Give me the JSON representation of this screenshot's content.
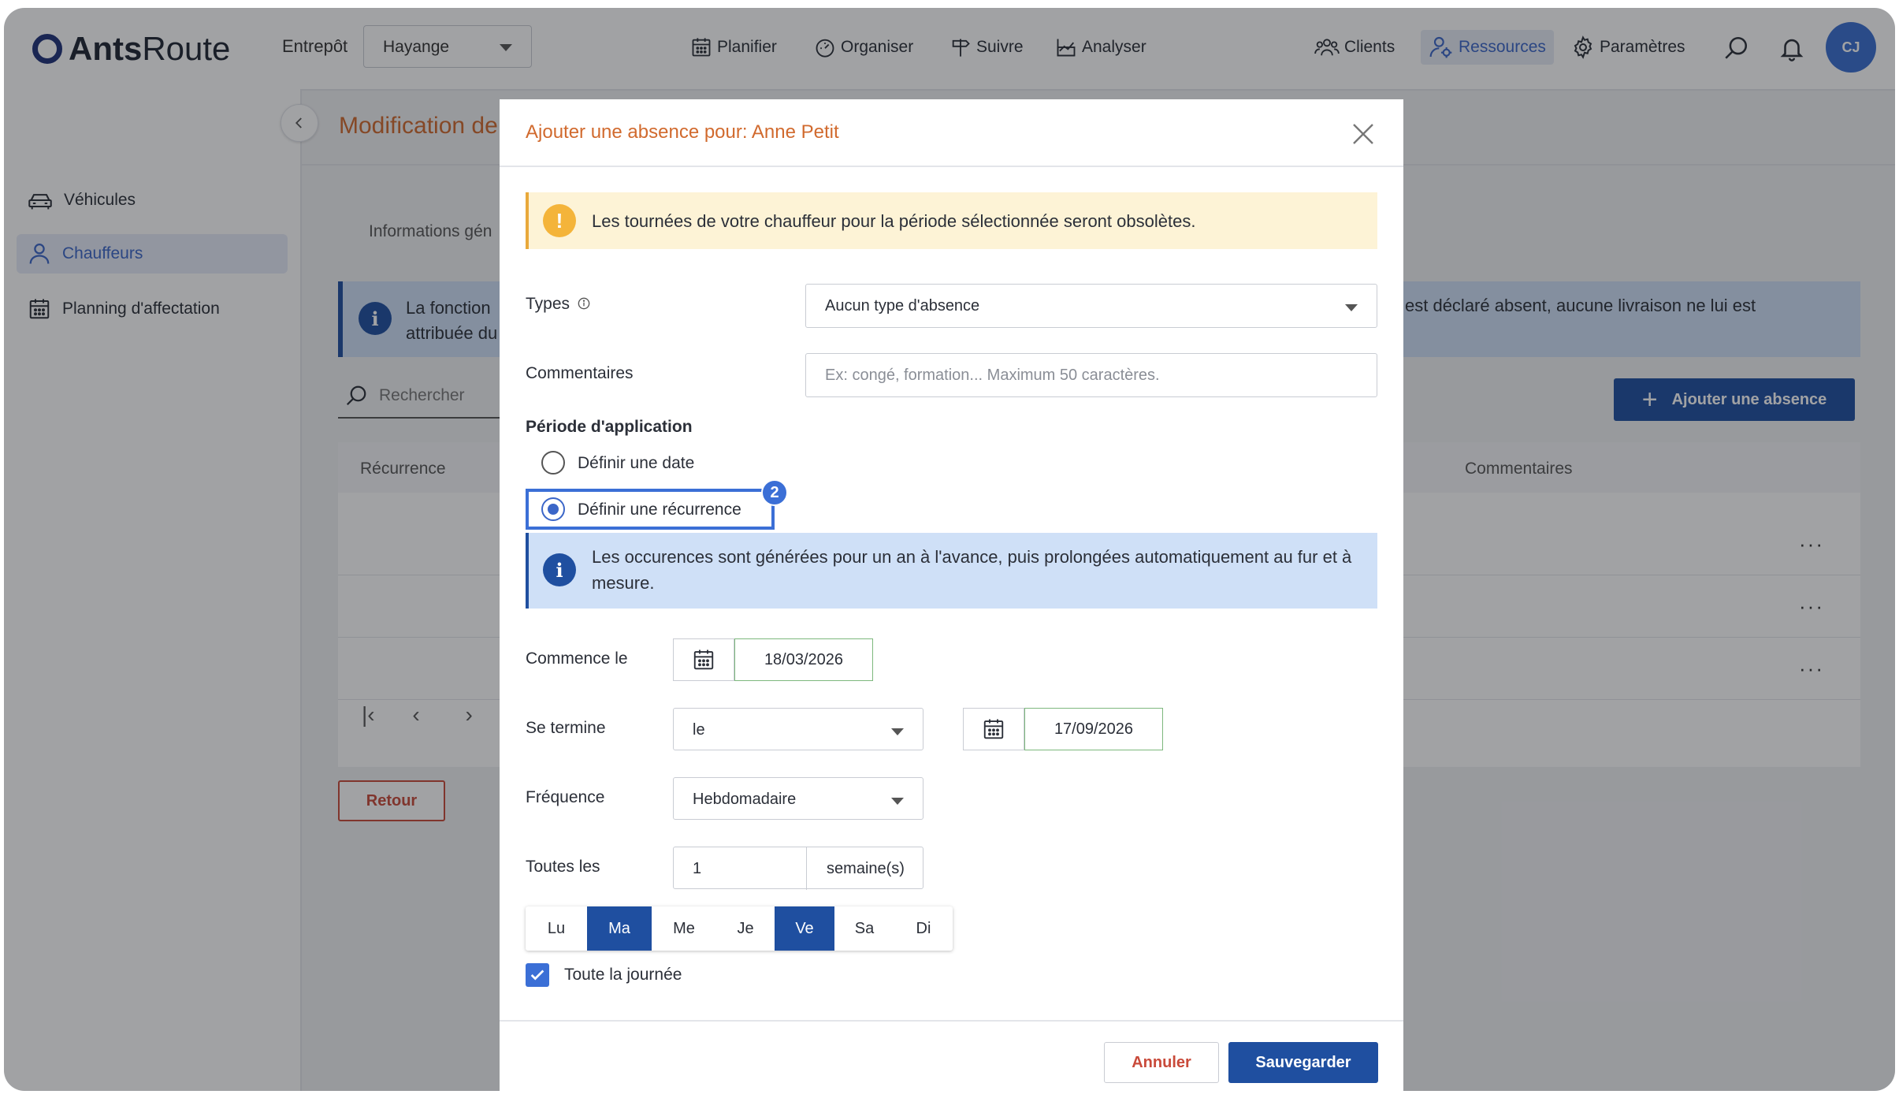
{
  "app": {
    "logo_bold": "Ants",
    "logo_light": "Route"
  },
  "header": {
    "warehouse_label": "Entrepôt",
    "warehouse_value": "Hayange",
    "nav": [
      {
        "label": "Planifier",
        "icon": "calendar-icon"
      },
      {
        "label": "Organiser",
        "icon": "gauge-icon"
      },
      {
        "label": "Suivre",
        "icon": "signpost-icon"
      },
      {
        "label": "Analyser",
        "icon": "chart-icon"
      }
    ],
    "right_nav": [
      {
        "label": "Clients",
        "icon": "users-icon"
      },
      {
        "label": "Ressources",
        "icon": "resources-icon",
        "active": true
      },
      {
        "label": "Paramètres",
        "icon": "gear-icon"
      }
    ],
    "avatar": "CJ"
  },
  "sidebar": {
    "items": [
      {
        "label": "Véhicules",
        "icon": "car-icon"
      },
      {
        "label": "Chauffeurs",
        "icon": "person-icon",
        "active": true
      },
      {
        "label": "Planning d'affectation",
        "icon": "calendar-icon"
      }
    ]
  },
  "page": {
    "title": "Modification de",
    "tab_info": "Informations gén",
    "banner_left": "La fonction attribuée du",
    "banner_right": "est déclaré absent, aucune livraison ne lui est",
    "search_placeholder": "Rechercher",
    "add_absence": "Ajouter une absence",
    "col_recurrence": "Récurrence",
    "col_comments": "Commentaires",
    "row_menu": "···",
    "back": "Retour"
  },
  "modal": {
    "title": "Ajouter une absence pour: Anne Petit",
    "warning": "Les tournées de votre chauffeur pour la période sélectionnée seront obsolètes.",
    "types_label": "Types",
    "types_value": "Aucun type d'absence",
    "comments_label": "Commentaires",
    "comments_placeholder": "Ex: congé, formation... Maximum 50 caractères.",
    "period_section": "Période d'application",
    "radio_date": "Définir une date",
    "radio_recurrence": "Définir une récurrence",
    "step_badge": "2",
    "recurrence_info": "Les occurences sont générées pour un an à l'avance, puis prolongées automatiquement au fur et à mesure.",
    "starts_label": "Commence le",
    "starts_value": "18/03/2026",
    "ends_label": "Se termine",
    "ends_mode": "le",
    "ends_value": "17/09/2026",
    "frequency_label": "Fréquence",
    "frequency_value": "Hebdomadaire",
    "every_label": "Toutes les",
    "every_value": "1",
    "every_unit": "semaine(s)",
    "days": [
      {
        "label": "Lu",
        "on": false
      },
      {
        "label": "Ma",
        "on": true
      },
      {
        "label": "Me",
        "on": false
      },
      {
        "label": "Je",
        "on": false
      },
      {
        "label": "Ve",
        "on": true
      },
      {
        "label": "Sa",
        "on": false
      },
      {
        "label": "Di",
        "on": false
      }
    ],
    "all_day": "Toute la journée",
    "cancel": "Annuler",
    "save": "Sauvegarder"
  },
  "colors": {
    "accent": "#1f4fa0",
    "title": "#d16a2e",
    "focus": "#3b6fd6"
  }
}
